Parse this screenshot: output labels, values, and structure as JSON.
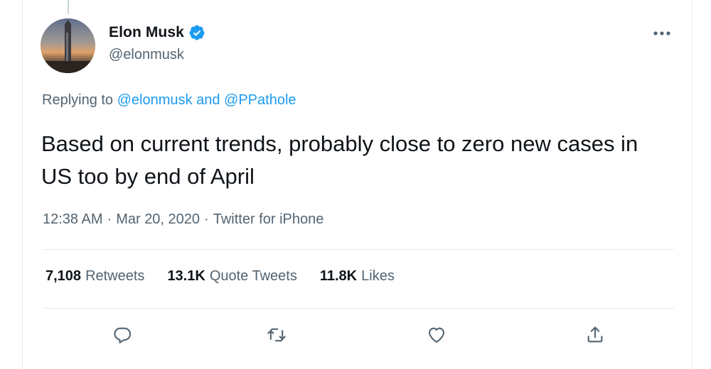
{
  "tweet": {
    "author": {
      "display_name": "Elon Musk",
      "handle": "@elonmusk",
      "verified": true
    },
    "reply_context": {
      "prefix": "Replying to",
      "mention_1": "@elonmusk",
      "conjunction": "and",
      "mention_2": "@PPathole"
    },
    "text": "Based on current trends, probably close to zero new cases in US too by end of April",
    "meta": {
      "time": "12:38 AM",
      "separator_1": "·",
      "date": "Mar 20, 2020",
      "separator_2": "·",
      "source": "Twitter for iPhone"
    },
    "stats": [
      {
        "count": "7,108",
        "label": "Retweets"
      },
      {
        "count": "13.1K",
        "label": "Quote Tweets"
      },
      {
        "count": "11.8K",
        "label": "Likes"
      }
    ],
    "actions": [
      "reply-icon",
      "retweet-icon",
      "like-icon",
      "share-icon"
    ],
    "more_icon": "more-horizontal-icon"
  },
  "colors": {
    "text_primary": "#0f1419",
    "text_secondary": "#536471",
    "accent": "#1d9bf0",
    "divider": "#e6ecf0"
  }
}
